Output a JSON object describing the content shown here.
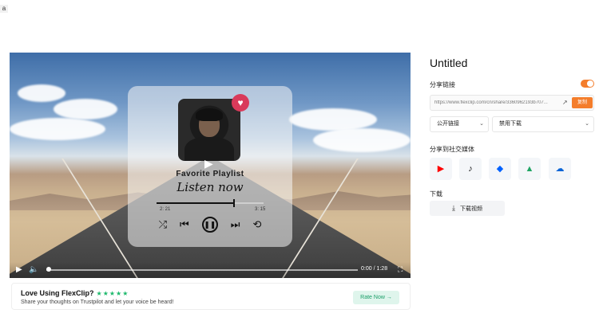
{
  "top_chip": "a",
  "video": {
    "card": {
      "playlist_title": "Favorite Playlist",
      "playlist_subtitle": "Listen now",
      "time_current": "2: 21",
      "time_total": "3: 15",
      "progress": 0.72
    },
    "controls": {
      "time": "0:00 / 1:28",
      "progress": 0.0
    }
  },
  "rate_banner": {
    "title": "Love Using FlexClip?",
    "stars": "★★★★★",
    "description": "Share your thoughts on Trustpilot and let your voice be heard!",
    "button": "Rate Now →"
  },
  "panel": {
    "title": "Untitled",
    "share_link_label": "分享链接",
    "share_enabled": true,
    "link_url": "https://www.flexclip.com/cn/share/3360962193b707...",
    "copy_label": "复制",
    "visibility_select": "公开链接",
    "download_select": "禁用下载",
    "social_label": "分享到社交媒体",
    "social": [
      {
        "name": "youtube",
        "icon": "▶",
        "color": "#ff0000"
      },
      {
        "name": "tiktok",
        "icon": "♪",
        "color": "#111111"
      },
      {
        "name": "dropbox",
        "icon": "◆",
        "color": "#0061fe"
      },
      {
        "name": "google-drive",
        "icon": "▲",
        "color": "#1fa463"
      },
      {
        "name": "onedrive",
        "icon": "☁",
        "color": "#0a64d6"
      }
    ],
    "download_label": "下载",
    "download_button": "下载视频"
  },
  "colors": {
    "accent": "#f47d2b",
    "rate_green": "#1a9e68"
  }
}
